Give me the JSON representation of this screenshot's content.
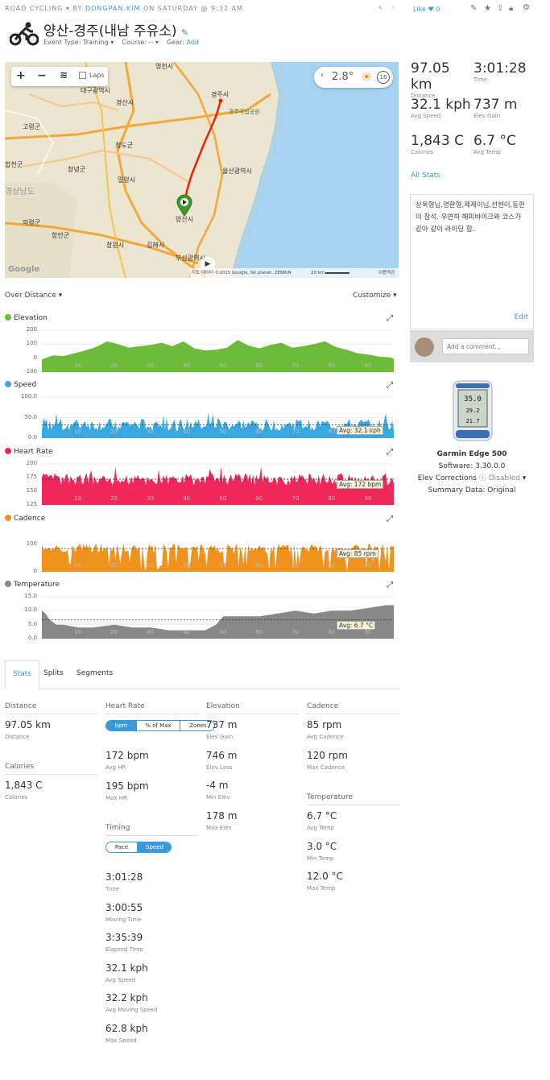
{
  "header": {
    "activity_type": "ROAD CYCLING",
    "by": "BY",
    "user": "DONGPAN.KIM",
    "date": "ON SATURDAY @ 9:32 AM",
    "title": "양산-경주(내남 주유소)",
    "event_type_label": "Event Type:",
    "event_type_value": "Training",
    "course_label": "Course:",
    "course_value": "--",
    "gear_label": "Gear:",
    "gear_value": "Add",
    "like_label": "Like",
    "like_count": "0"
  },
  "map": {
    "laps_label": "Laps",
    "temperature": "2.8°",
    "wind": "16",
    "places": [
      {
        "name": "영천시"
      },
      {
        "name": "대구광역시"
      },
      {
        "name": "경산시"
      },
      {
        "name": "경주시"
      },
      {
        "name": "경주국립공원"
      },
      {
        "name": "고령군"
      },
      {
        "name": "청도군"
      },
      {
        "name": "합천군"
      },
      {
        "name": "창녕군"
      },
      {
        "name": "밀양시"
      },
      {
        "name": "울산광역시"
      },
      {
        "name": "경상남도"
      },
      {
        "name": "양산시"
      },
      {
        "name": "의령군"
      },
      {
        "name": "함안군"
      },
      {
        "name": "창원시"
      },
      {
        "name": "김해시"
      },
      {
        "name": "부산광역시"
      }
    ],
    "attribution": "지도 데이터 ©2015 Google, SK planet, ZENRIN",
    "scale": "20 km",
    "terms": "이용약관",
    "google": "Google"
  },
  "summary": {
    "distance": {
      "value": "97.05 km",
      "label": "Distance"
    },
    "time": {
      "value": "3:01:28",
      "label": "Time"
    },
    "avg_speed": {
      "value": "32.1 kph",
      "label": "Avg Speed"
    },
    "elev_gain": {
      "value": "737 m",
      "label": "Elev Gain"
    },
    "calories": {
      "value": "1,843 C",
      "label": "Calories"
    },
    "avg_temp": {
      "value": "6.7 °C",
      "label": "Avg Temp"
    },
    "all_stats": "All Stats"
  },
  "notes": {
    "text": "상욱형님,명환형,제제이님,선현이,동판이 참석. 우연히 해피바이크와 코스가 같아 같이 라이딩 함.",
    "edit": "Edit",
    "comment_placeholder": "Add a comment..."
  },
  "device": {
    "name": "Garmin Edge 500",
    "software": "Software: 3.30.0.0",
    "elev_corrections_label": "Elev Corrections",
    "elev_corrections_value": "Disabled",
    "summary_data": "Summary Data: Original",
    "screen_values": [
      "35.0",
      "29.2",
      "21.7"
    ]
  },
  "charts_header": {
    "over_distance": "Over Distance",
    "customize": "Customize"
  },
  "chart_data": [
    {
      "type": "area",
      "name": "Elevation",
      "color": "#6dbb3b",
      "y_ticks": [
        "200",
        "100",
        "0",
        "-100"
      ],
      "ylim": [
        -100,
        200
      ],
      "x_ticks": [
        "10",
        "20",
        "30",
        "40",
        "50",
        "60",
        "70",
        "80",
        "90"
      ],
      "xlim": [
        0,
        97
      ],
      "x": [
        0,
        3,
        6,
        9,
        12,
        15,
        18,
        21,
        24,
        27,
        30,
        33,
        36,
        39,
        42,
        45,
        48,
        51,
        54,
        57,
        60,
        63,
        66,
        69,
        72,
        75,
        78,
        81,
        84,
        87,
        90,
        93,
        96,
        97
      ],
      "values": [
        -10,
        20,
        15,
        35,
        55,
        80,
        120,
        100,
        75,
        85,
        95,
        110,
        85,
        120,
        70,
        55,
        60,
        75,
        130,
        90,
        70,
        95,
        110,
        75,
        85,
        100,
        120,
        80,
        60,
        35,
        25,
        10,
        5,
        -5
      ]
    },
    {
      "type": "area",
      "name": "Speed",
      "color": "#3aa8e0",
      "y_ticks": [
        "100.0",
        "50.0",
        "0.0"
      ],
      "ylim": [
        0,
        100
      ],
      "x_ticks": [
        "10",
        "20",
        "30",
        "40",
        "50",
        "60",
        "70",
        "80",
        "90"
      ],
      "xlim": [
        0,
        97
      ],
      "avg_label": "Avg: 32.1 kph",
      "average": 32.1
    },
    {
      "type": "area",
      "name": "Heart Rate",
      "color": "#f0275a",
      "y_ticks": [
        "200",
        "175",
        "150",
        "125"
      ],
      "ylim": [
        125,
        200
      ],
      "x_ticks": [
        "10",
        "20",
        "30",
        "40",
        "50",
        "60",
        "70",
        "80",
        "90"
      ],
      "xlim": [
        0,
        97
      ],
      "avg_label": "Avg: 172 bpm",
      "average": 172
    },
    {
      "type": "area",
      "name": "Cadence",
      "color": "#f0921e",
      "y_ticks": [
        "100",
        "0"
      ],
      "ylim": [
        0,
        150
      ],
      "x_ticks": [
        "10",
        "20",
        "30",
        "40",
        "50",
        "60",
        "70",
        "80",
        "90"
      ],
      "xlim": [
        0,
        97
      ],
      "avg_label": "Avg: 85 rpm",
      "average": 85
    },
    {
      "type": "area",
      "name": "Temperature",
      "color": "#888888",
      "y_ticks": [
        "15.0",
        "10.0",
        "5.0",
        "0.0"
      ],
      "ylim": [
        0,
        15
      ],
      "x_ticks": [
        "10",
        "20",
        "30",
        "40",
        "50",
        "60",
        "70",
        "80",
        "90"
      ],
      "xlim": [
        0,
        97
      ],
      "avg_label": "Avg: 6.7 °C",
      "average": 6.7,
      "x": [
        0,
        1,
        2,
        4,
        6,
        10,
        14,
        20,
        25,
        30,
        35,
        40,
        45,
        48,
        50,
        55,
        60,
        65,
        70,
        75,
        80,
        85,
        90,
        95,
        97
      ],
      "values": [
        10,
        9,
        7,
        5,
        5,
        4,
        4,
        5,
        4,
        4,
        3,
        3,
        3,
        5,
        8,
        8,
        8,
        9,
        10,
        9,
        10,
        10,
        11,
        12,
        12
      ]
    }
  ],
  "tabs": [
    "Stats",
    "Splits",
    "Segments"
  ],
  "stats": {
    "distance": {
      "title": "Distance",
      "value": "97.05 km",
      "label": "Distance"
    },
    "calories": {
      "title": "Calories",
      "value": "1,843 C",
      "label": "Calories"
    },
    "heart_rate": {
      "title": "Heart Rate",
      "toggle": [
        "bpm",
        "% of Max",
        "Zones"
      ],
      "avg": {
        "value": "172 bpm",
        "label": "Avg HR"
      },
      "max": {
        "value": "195 bpm",
        "label": "Max HR"
      }
    },
    "timing": {
      "title": "Timing",
      "toggle": [
        "Pace",
        "Speed"
      ],
      "items": [
        {
          "value": "3:01:28",
          "label": "Time"
        },
        {
          "value": "3:00:55",
          "label": "Moving Time"
        },
        {
          "value": "3:35:39",
          "label": "Elapsed Time"
        },
        {
          "value": "32.1 kph",
          "label": "Avg Speed"
        },
        {
          "value": "32.2 kph",
          "label": "Avg Moving Speed"
        },
        {
          "value": "62.8 kph",
          "label": "Max Speed"
        }
      ]
    },
    "elevation": {
      "title": "Elevation",
      "items": [
        {
          "value": "737 m",
          "label": "Elev Gain"
        },
        {
          "value": "746 m",
          "label": "Elev Loss"
        },
        {
          "value": "-4 m",
          "label": "Min Elev"
        },
        {
          "value": "178 m",
          "label": "Max Elev"
        }
      ]
    },
    "cadence": {
      "title": "Cadence",
      "items": [
        {
          "value": "85 rpm",
          "label": "Avg Cadence"
        },
        {
          "value": "120 rpm",
          "label": "Max Cadence"
        }
      ]
    },
    "temperature": {
      "title": "Temperature",
      "items": [
        {
          "value": "6.7 °C",
          "label": "Avg Temp"
        },
        {
          "value": "3.0 °C",
          "label": "Min Temp"
        },
        {
          "value": "12.0 °C",
          "label": "Max Temp"
        }
      ]
    }
  }
}
